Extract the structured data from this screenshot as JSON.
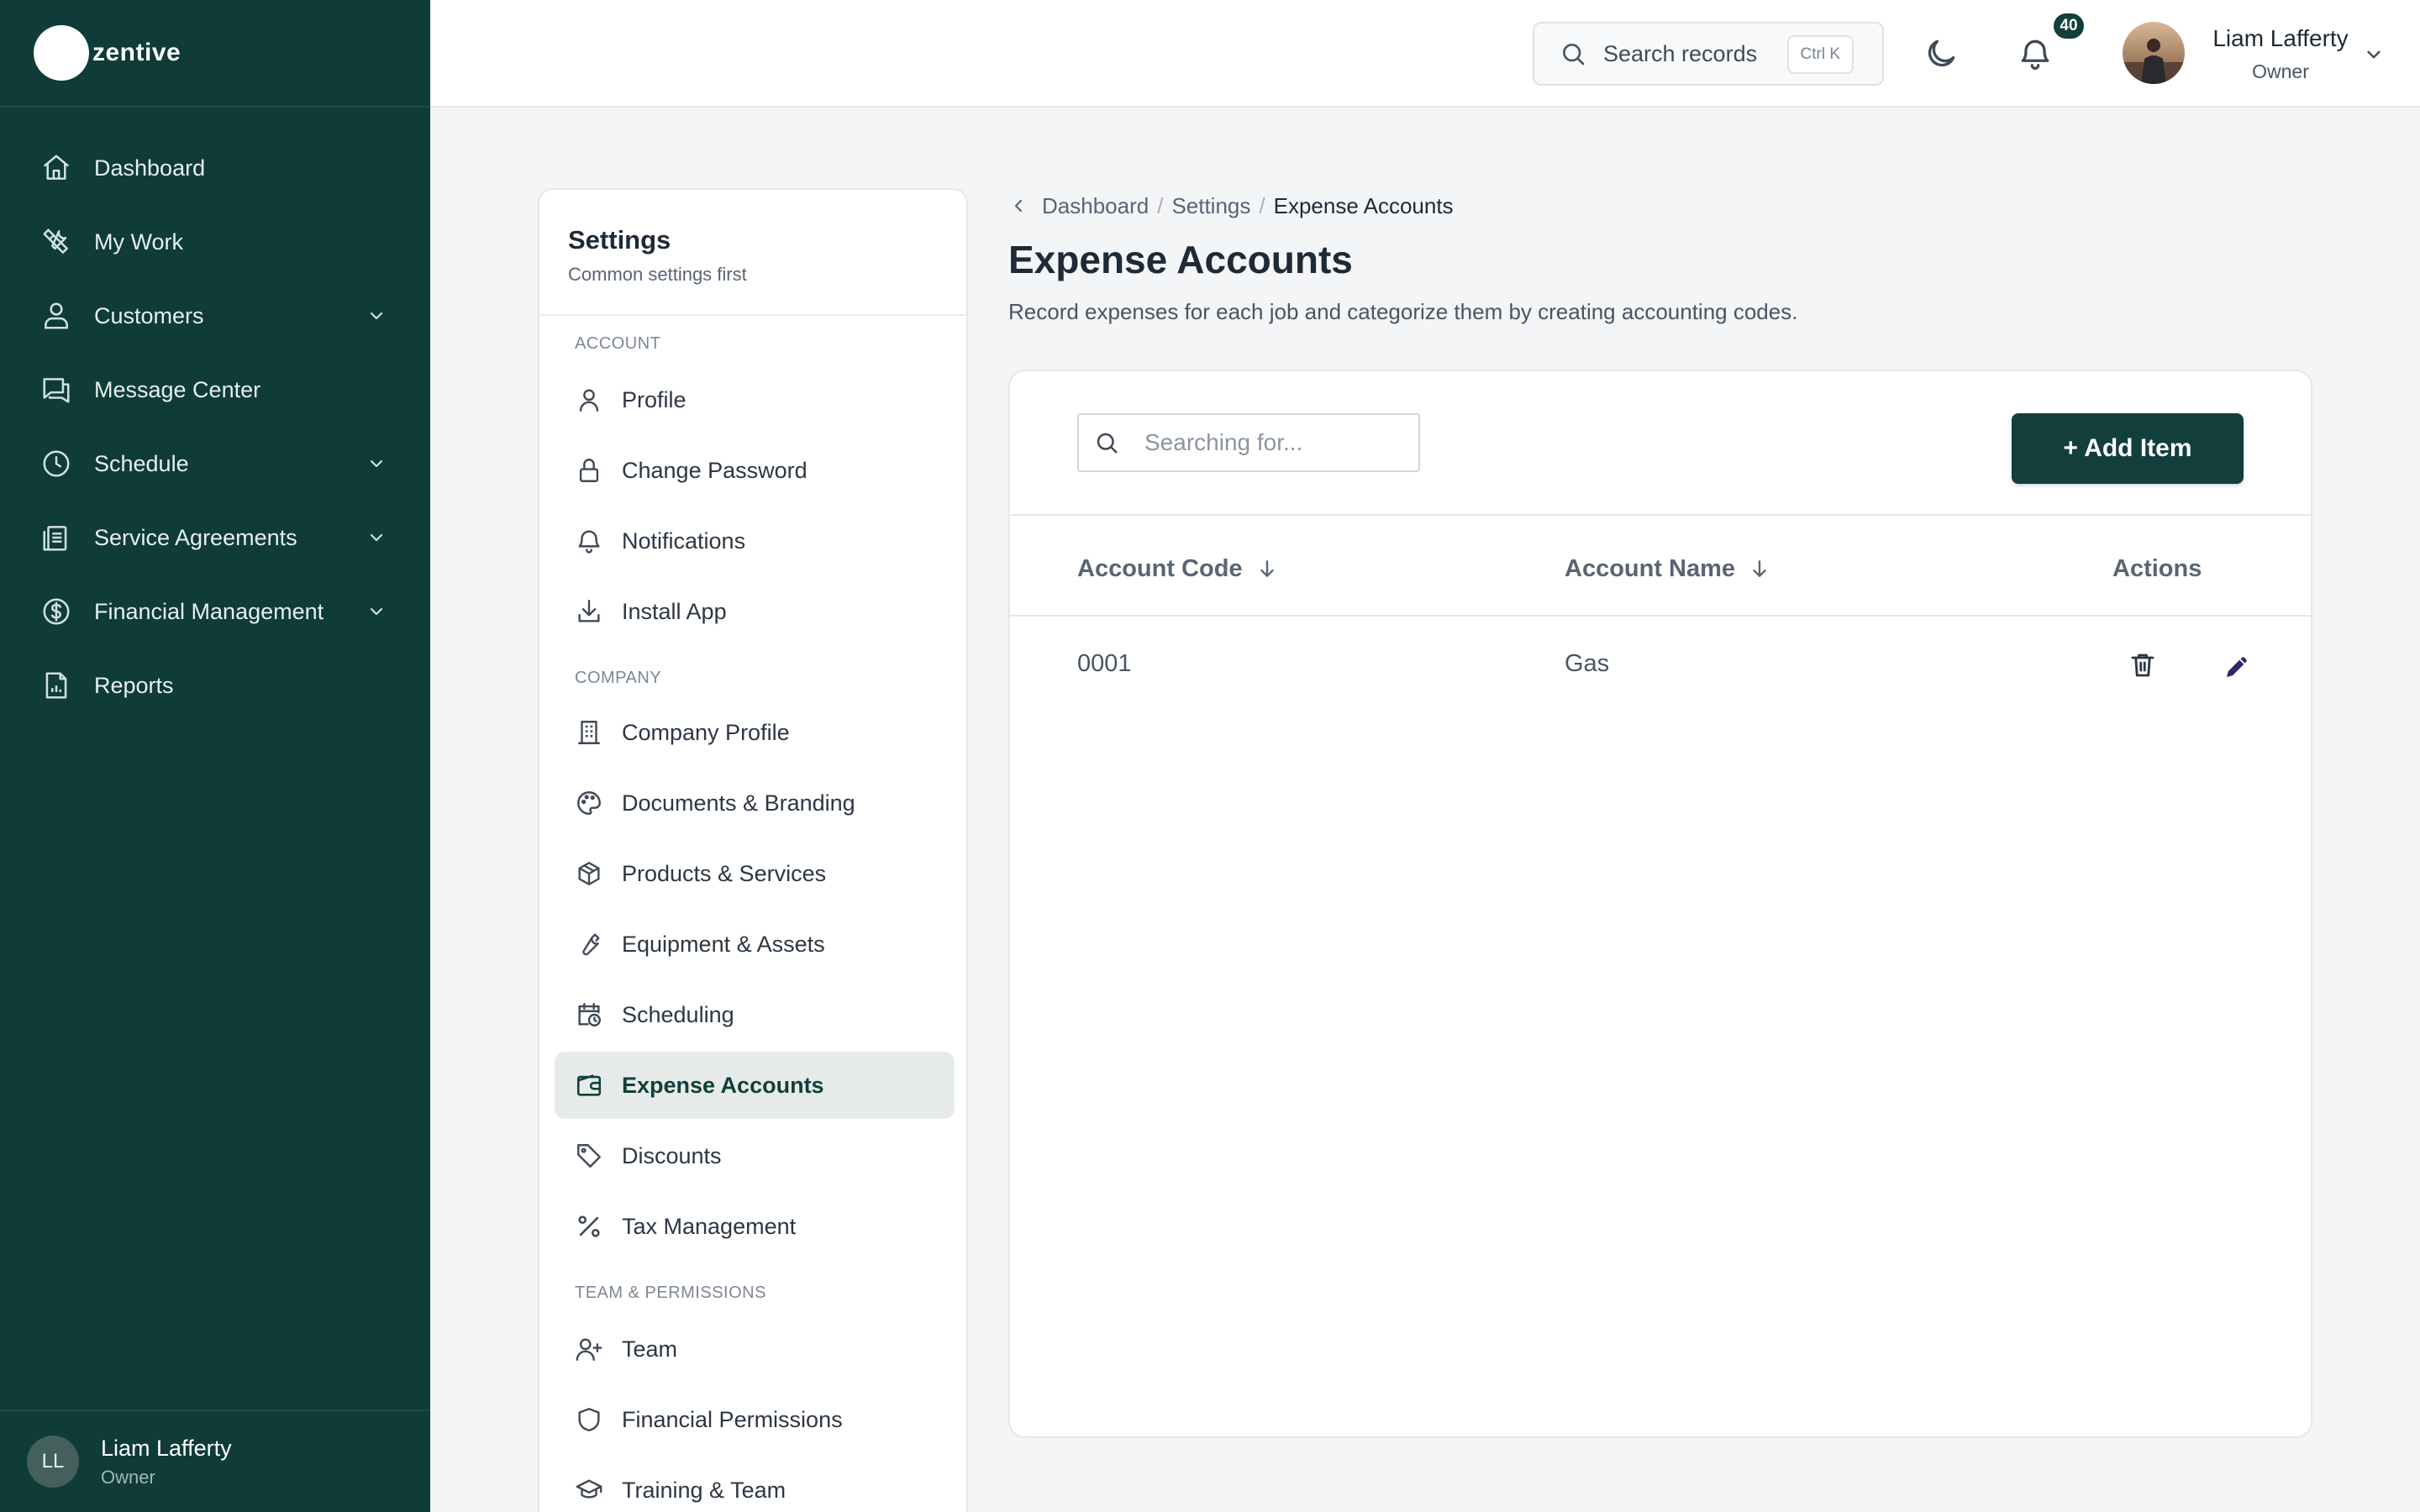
{
  "app": {
    "logo_text": "zentive"
  },
  "sidebar": {
    "items": [
      {
        "label": "Dashboard"
      },
      {
        "label": "My Work"
      },
      {
        "label": "Customers"
      },
      {
        "label": "Message Center"
      },
      {
        "label": "Schedule"
      },
      {
        "label": "Service Agreements"
      },
      {
        "label": "Financial Management"
      },
      {
        "label": "Reports"
      }
    ],
    "user": {
      "initials": "LL",
      "name": "Liam Lafferty",
      "role": "Owner"
    }
  },
  "header": {
    "search_label": "Search records",
    "search_shortcut": "Ctrl K",
    "notification_count": "40",
    "user_name": "Liam Lafferty",
    "user_role": "Owner"
  },
  "settings": {
    "title": "Settings",
    "subtitle": "Common settings first",
    "sections": {
      "account": "ACCOUNT",
      "company": "COMPANY",
      "team": "TEAM & PERMISSIONS"
    },
    "items": [
      {
        "label": "Profile"
      },
      {
        "label": "Change Password"
      },
      {
        "label": "Notifications"
      },
      {
        "label": "Install App"
      },
      {
        "label": "Company Profile"
      },
      {
        "label": "Documents & Branding"
      },
      {
        "label": "Products & Services"
      },
      {
        "label": "Equipment & Assets"
      },
      {
        "label": "Scheduling"
      },
      {
        "label": "Expense Accounts"
      },
      {
        "label": "Discounts"
      },
      {
        "label": "Tax Management"
      },
      {
        "label": "Team"
      },
      {
        "label": "Financial Permissions"
      },
      {
        "label": "Training & Team"
      }
    ]
  },
  "breadcrumb": [
    "Dashboard",
    "Settings",
    "Expense Accounts"
  ],
  "page": {
    "title": "Expense Accounts",
    "description": "Record expenses for each job and categorize them by creating accounting codes."
  },
  "table": {
    "search_placeholder": "Searching for...",
    "add_button": "+ Add Item",
    "columns": [
      "Account Code",
      "Account Name",
      "Actions"
    ],
    "rows": [
      {
        "code": "0001",
        "name": "Gas"
      }
    ]
  },
  "colors": {
    "brand": "#0f3b38",
    "button": "#123f3b",
    "edit_icon": "#2b2a6b"
  }
}
